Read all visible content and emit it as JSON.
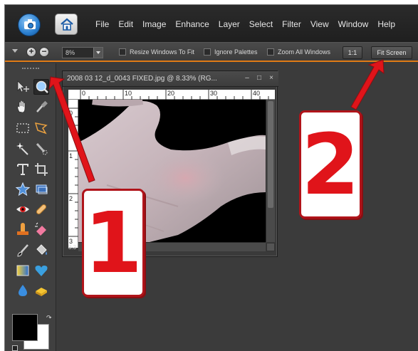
{
  "menu": {
    "items": [
      "File",
      "Edit",
      "Image",
      "Enhance",
      "Layer",
      "Select",
      "Filter",
      "View",
      "Window",
      "Help"
    ]
  },
  "options_bar": {
    "zoom_value": "8%",
    "resize_windows_label": "Resize Windows To Fit",
    "ignore_palettes_label": "Ignore Palettes",
    "zoom_all_windows_label": "Zoom All Windows",
    "one_to_one_label": "1:1",
    "fit_screen_label": "Fit Screen"
  },
  "document": {
    "title": "2008 03 12_d_0043 FIXED.jpg @ 8.33% (RG...",
    "zoom_status": "8.3",
    "ruler_top": [
      "0",
      "10",
      "20",
      "30",
      "40"
    ],
    "ruler_left": [
      "0",
      "1",
      "2",
      "3"
    ]
  },
  "callouts": {
    "one": "1",
    "two": "2"
  },
  "colors": {
    "accent_orange": "#e07b15",
    "callout_red": "#e0141a",
    "arrow_red": "#e0141a"
  },
  "icons": [
    "app-logo-icon",
    "home-icon",
    "move-icon",
    "zoom-icon",
    "hand-icon",
    "eyedropper-icon",
    "marquee-icon",
    "lasso-icon",
    "magic-wand-icon",
    "quick-selection-icon",
    "type-icon",
    "crop-icon",
    "cookie-cutter-icon",
    "straighten-icon",
    "red-eye-icon",
    "healing-brush-icon",
    "clone-stamp-icon",
    "eraser-icon",
    "brush-icon",
    "paint-bucket-icon",
    "gradient-icon",
    "custom-shape-icon",
    "blur-icon",
    "sponge-icon"
  ]
}
